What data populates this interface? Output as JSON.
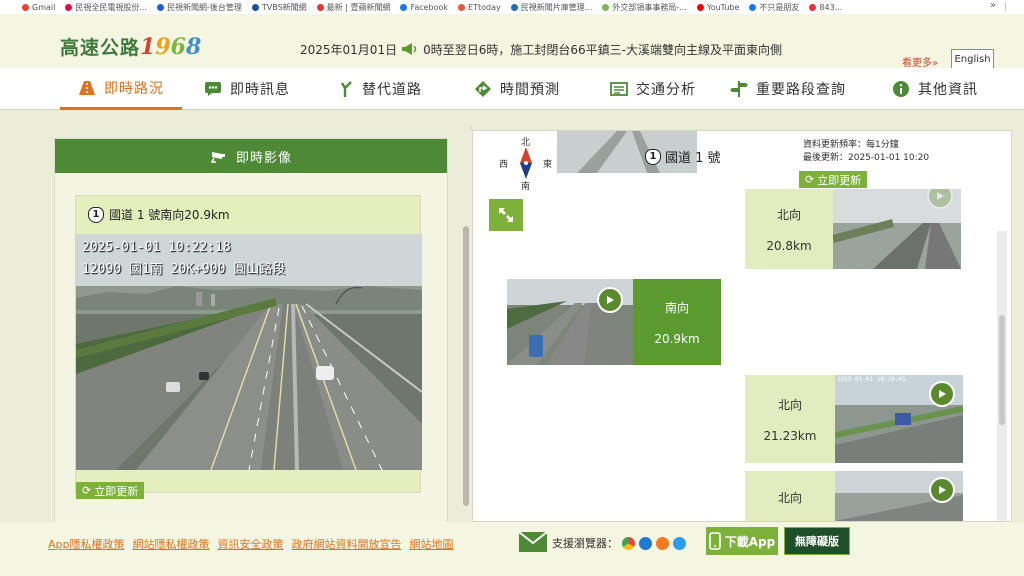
{
  "bookmarks": [
    {
      "label": "Gmail",
      "color": "#e94235"
    },
    {
      "label": "民視全民電視股份...",
      "color": "#d14"
    },
    {
      "label": "民視新聞網-後台管理",
      "color": "#2a5bd7"
    },
    {
      "label": "TVBS新聞網",
      "color": "#1b4fa0"
    },
    {
      "label": "最新 | 壹蘋新聞網",
      "color": "#e33"
    },
    {
      "label": "Facebook",
      "color": "#1877f2"
    },
    {
      "label": "ETtoday",
      "color": "#e53"
    },
    {
      "label": "民視新聞片庫管理...",
      "color": "#1d6fb8"
    },
    {
      "label": "外交部領事事務局-...",
      "color": "#7ab648"
    },
    {
      "label": "YouTube",
      "color": "#f00"
    },
    {
      "label": "不只是朋友",
      "color": "#1877f2"
    },
    {
      "label": "843...",
      "color": "#e33"
    }
  ],
  "bookmark_more": "»",
  "logo": {
    "text": "高速公路",
    "year": [
      "1",
      "9",
      "6",
      "8"
    ]
  },
  "ticker": {
    "date": "2025年01月01日",
    "text": "0時至翌日6時，施工封閉台66平鎮三-大溪端雙向主線及平面東向側"
  },
  "see_more": "看更多»",
  "lang_button": "English",
  "nav": [
    {
      "label": "即時路況",
      "active": true
    },
    {
      "label": "即時訊息"
    },
    {
      "label": "替代道路"
    },
    {
      "label": "時間預測"
    },
    {
      "label": "交通分析"
    },
    {
      "label": "重要路段查詢"
    },
    {
      "label": "其他資訊"
    }
  ],
  "left_panel": {
    "title": "即時影像",
    "route_num": "1",
    "camera_title": "國道 1 號南向20.9km",
    "overlay_line1": "2025-01-01  10:22:18",
    "overlay_line2": "12090 國1南 20K+900 圓山路段",
    "refresh": "立即更新"
  },
  "right_panel": {
    "compass": {
      "n": "北",
      "s": "南",
      "w": "西",
      "e": "東"
    },
    "route_num": "1",
    "route_title": "國道 1 號",
    "update_freq": "資料更新頻率：每1分鐘",
    "last_update": "最後更新：2025-01-01 10:20",
    "refresh": "立即更新",
    "segments": [
      {
        "dir": "北向",
        "km": "20.8km"
      },
      {
        "dir": "南向",
        "km": "20.9km"
      },
      {
        "dir": "北向",
        "km": "21.23km"
      },
      {
        "dir": "北向",
        "km": ""
      }
    ],
    "thumb_overlay": "2025-01-01 10:20:45"
  },
  "footer": {
    "links": [
      "App隱私權政策",
      "網站隱私權政策",
      "資訊安全政策",
      "政府網站資料開放宣告",
      "網站地圖"
    ],
    "browser_label": "支援瀏覽器：",
    "browsers": [
      {
        "name": "chrome",
        "color": "#e8453c"
      },
      {
        "name": "edge",
        "color": "#1f7ad6"
      },
      {
        "name": "firefox",
        "color": "#f57a1f"
      },
      {
        "name": "safari",
        "color": "#2c9bf0"
      }
    ],
    "download": "下載App",
    "accessibility": "無障礙版"
  }
}
